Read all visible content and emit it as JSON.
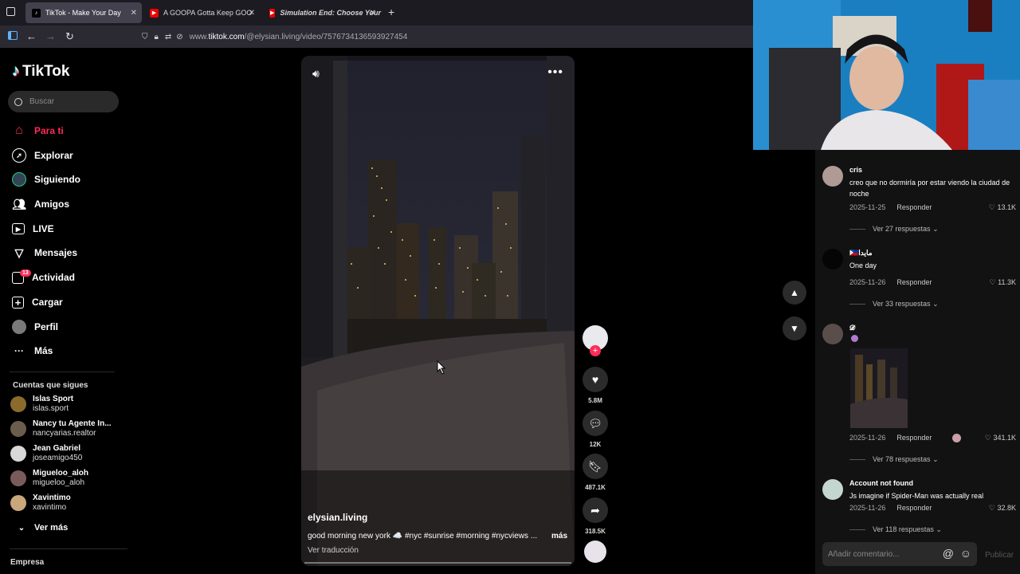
{
  "browser": {
    "tabs": [
      {
        "title": "TikTok - Make Your Day",
        "active": true
      },
      {
        "title": "A GOOPA Gotta Keep GOOPIN",
        "active": false
      },
      {
        "title": "Simulation End: Choose Your",
        "active": false
      }
    ],
    "url_prefix": "www.",
    "url_domain": "tiktok.com",
    "url_path": "/@elysian.living/video/7576734136593927454"
  },
  "sidebar": {
    "logo": "TikTok",
    "search_placeholder": "Buscar",
    "nav": [
      {
        "label": "Para ti",
        "icon": "home-icon"
      },
      {
        "label": "Explorar",
        "icon": "compass-icon"
      },
      {
        "label": "Siguiendo",
        "icon": "following-icon"
      },
      {
        "label": "Amigos",
        "icon": "friends-icon"
      },
      {
        "label": "LIVE",
        "icon": "live-icon"
      },
      {
        "label": "Mensajes",
        "icon": "messages-icon"
      },
      {
        "label": "Actividad",
        "icon": "activity-icon",
        "badge": "13"
      },
      {
        "label": "Cargar",
        "icon": "upload-icon"
      },
      {
        "label": "Perfil",
        "icon": "profile-avatar"
      },
      {
        "label": "Más",
        "icon": "more-icon"
      }
    ],
    "following_title": "Cuentas que sigues",
    "following": [
      {
        "name": "Islas Sport",
        "handle": "islas.sport"
      },
      {
        "name": "Nancy tu Agente In...",
        "handle": "nancyarias.realtor"
      },
      {
        "name": "Jean Gabriel",
        "handle": "joseamigo450"
      },
      {
        "name": "Migueloo_aloh",
        "handle": "migueloo_aloh"
      },
      {
        "name": "Xavintimo",
        "handle": "xavintimo"
      }
    ],
    "see_more": "Ver más",
    "footer": "Empresa"
  },
  "video": {
    "username": "elysian.living",
    "description": "good morning new york ☁️ #nyc #sunrise #morning #nycviews ...",
    "more": "más",
    "translate": "Ver traducción",
    "likes": "5.8M",
    "comments": "12K",
    "saves": "487.1K",
    "shares": "318.5K"
  },
  "comments": [
    {
      "name": "cris",
      "text": "creo que no dormiría por estar viendo la ciudad de noche",
      "date": "2025-11-25",
      "reply": "Responder",
      "likes": "13.1K",
      "replies": "Ver 27 respuestas"
    },
    {
      "name": "🇵🇭مايدا",
      "text": "One day",
      "date": "2025-11-26",
      "reply": "Responder",
      "likes": "11.3K",
      "replies": "Ver 33 respuestas"
    },
    {
      "name": "𝓓",
      "text": "",
      "date": "2025-11-26",
      "reply": "Responder",
      "likes": "341.1K",
      "replies": "Ver 78 respuestas"
    },
    {
      "name": "Account not found",
      "text": "Js imagine if Spider-Man was actually real",
      "date": "2025-11-26",
      "reply": "Responder",
      "likes": "32.8K",
      "replies": "Ver 118 respuestas"
    }
  ],
  "comment_input": {
    "placeholder": "Añadir comentario...",
    "publish": "Publicar"
  },
  "colors": {
    "accent": "#fe2c55",
    "background": "#000000",
    "panel": "#121212"
  }
}
